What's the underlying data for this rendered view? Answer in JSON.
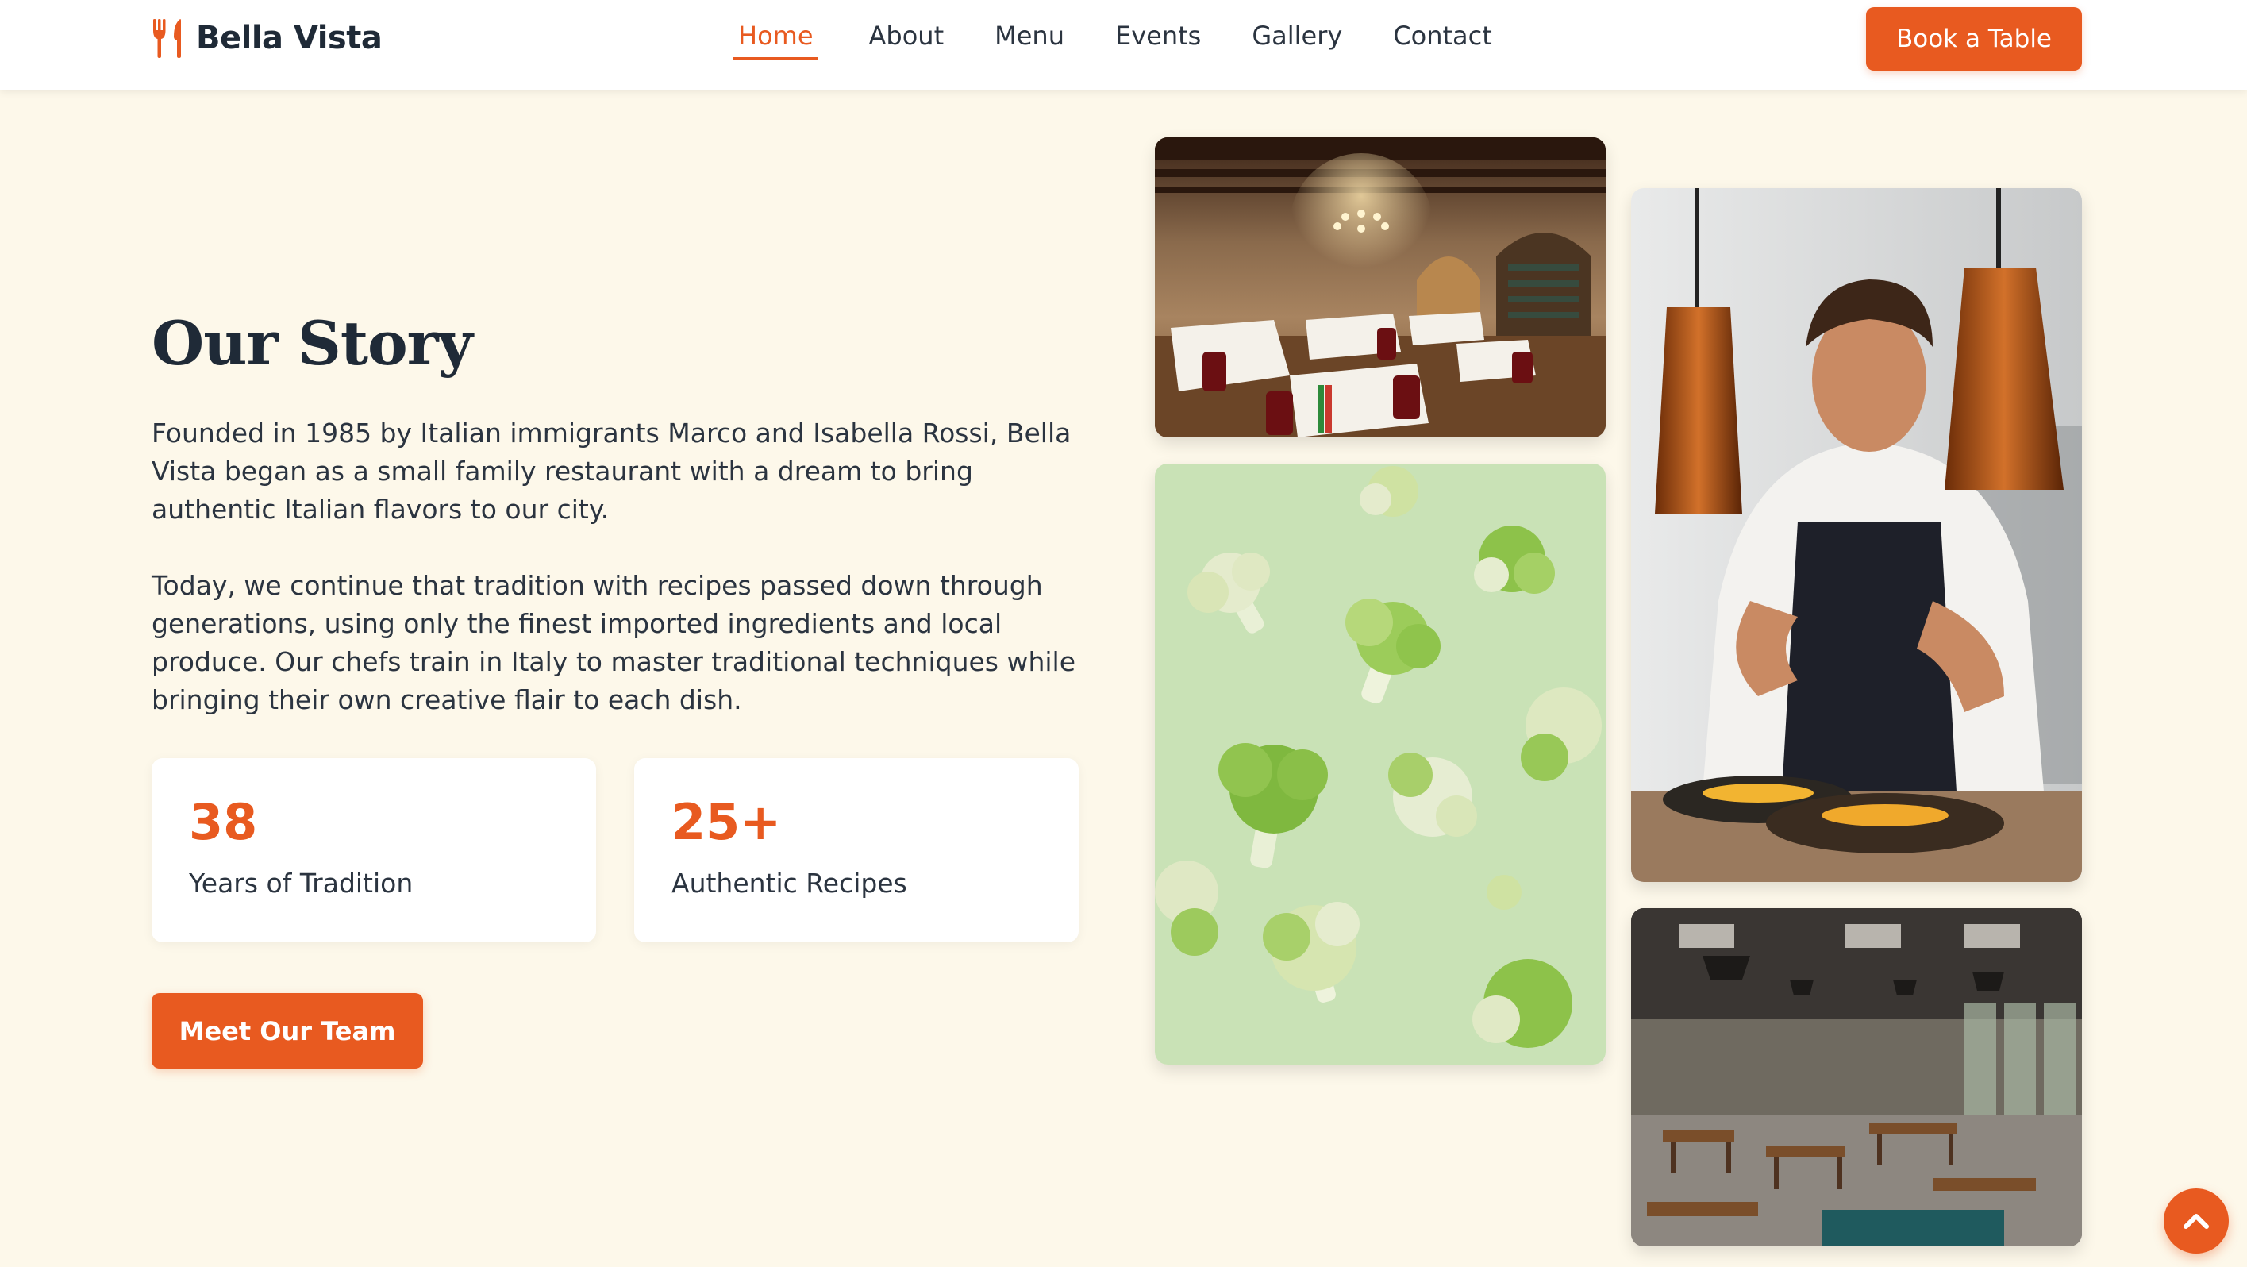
{
  "brand": {
    "name": "Bella Vista",
    "icon": "fork-knife-icon",
    "accent_color": "#e85a20"
  },
  "nav": {
    "items": [
      {
        "label": "Home",
        "active": true
      },
      {
        "label": "About",
        "active": false
      },
      {
        "label": "Menu",
        "active": false
      },
      {
        "label": "Events",
        "active": false
      },
      {
        "label": "Gallery",
        "active": false
      },
      {
        "label": "Contact",
        "active": false
      }
    ],
    "cta_label": "Book a Table"
  },
  "story": {
    "title": "Our Story",
    "paragraph1": "Founded in 1985 by Italian immigrants Marco and Isabella Rossi, Bella Vista began as a small family restaurant with a dream to bring authentic Italian flavors to our city.",
    "paragraph2": "Today, we continue that tradition with recipes passed down through generations, using only the finest imported ingredients and local produce. Our chefs train in Italy to master traditional techniques while bringing their own creative flair to each dish.",
    "stats": [
      {
        "value": "38",
        "label": "Years of Tradition"
      },
      {
        "value": "25+",
        "label": "Authentic Recipes"
      }
    ],
    "button_label": "Meet Our Team"
  },
  "gallery": {
    "images": [
      "restaurant-dining-room",
      "cauliflower-florets",
      "chef-plating-dish",
      "industrial-cafe-interior"
    ]
  },
  "scroll_top": {
    "icon": "chevron-up-icon"
  }
}
